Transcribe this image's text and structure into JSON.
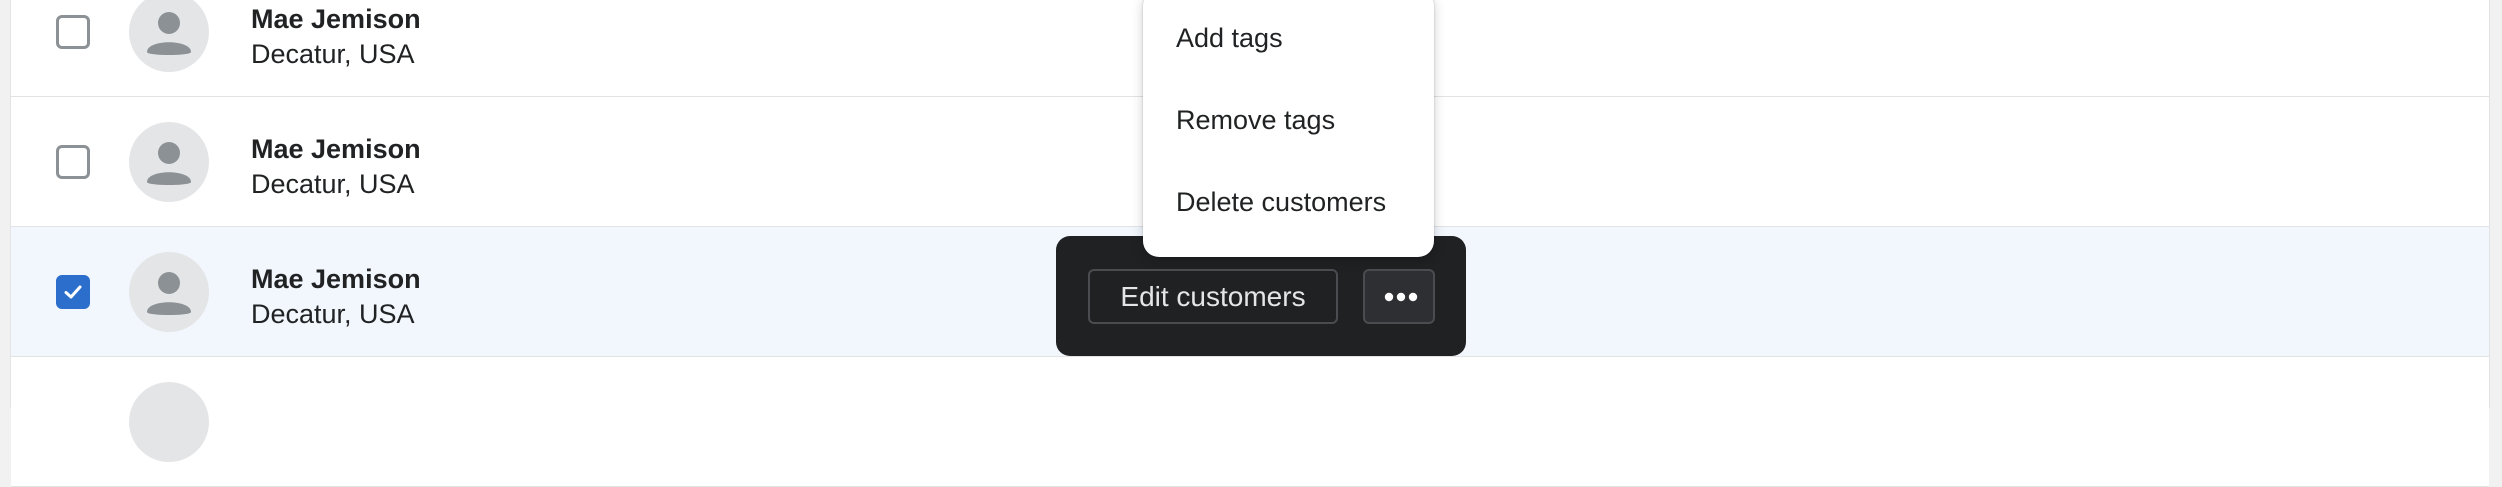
{
  "customers": [
    {
      "name": "Mae Jemison",
      "location": "Decatur, USA",
      "selected": false
    },
    {
      "name": "Mae Jemison",
      "location": "Decatur, USA",
      "selected": false
    },
    {
      "name": "Mae Jemison",
      "location": "Decatur, USA",
      "selected": true
    }
  ],
  "bulk_actions": {
    "edit_label": "Edit customers",
    "more_icon": "more-horizontal-icon"
  },
  "more_actions_menu": {
    "items": [
      {
        "label": "Add tags"
      },
      {
        "label": "Remove tags"
      },
      {
        "label": "Delete customers"
      }
    ]
  },
  "colors": {
    "selected_row_bg": "#f2f7fe",
    "checkbox_checked": "#2c6ecb",
    "bulk_bar_bg": "#202123"
  }
}
